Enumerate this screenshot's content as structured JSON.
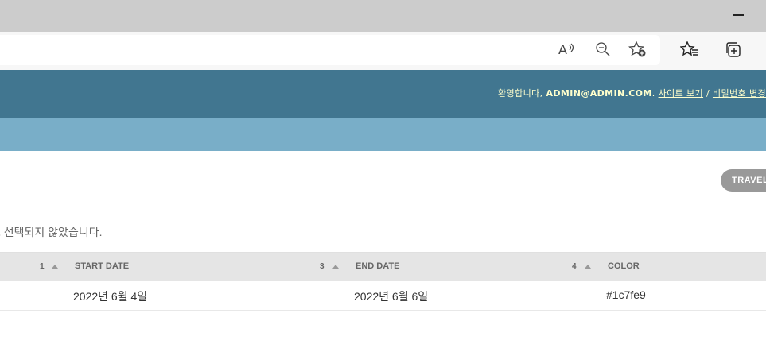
{
  "toolbar": {
    "icons": [
      "read-aloud-icon",
      "zoom-out-icon",
      "add-favorite-icon",
      "favorites-icon",
      "collections-icon"
    ]
  },
  "header": {
    "welcome": "환영합니다, ",
    "username": "ADMIN@ADMIN.COM",
    "separator1": ". ",
    "view_site": "사이트 보기",
    "separator2": " / ",
    "change_password": "비밀번호 변경"
  },
  "object_tools": {
    "label": "TRAVEL"
  },
  "message": "도 선택되지 않았습니다.",
  "table": {
    "columns": [
      {
        "sort_priority": "1",
        "label": "START DATE"
      },
      {
        "sort_priority": "3",
        "label": "END DATE"
      },
      {
        "sort_priority": "4",
        "label": "COLOR"
      }
    ],
    "rows": [
      {
        "start_date": "2022년 6월 4일",
        "end_date": "2022년 6월 6일",
        "color": "#1c7fe9"
      }
    ]
  },
  "colors": {
    "header_bg": "#417690",
    "breadcrumbs_bg": "#79aec8",
    "user_text": "#ffffcc"
  }
}
